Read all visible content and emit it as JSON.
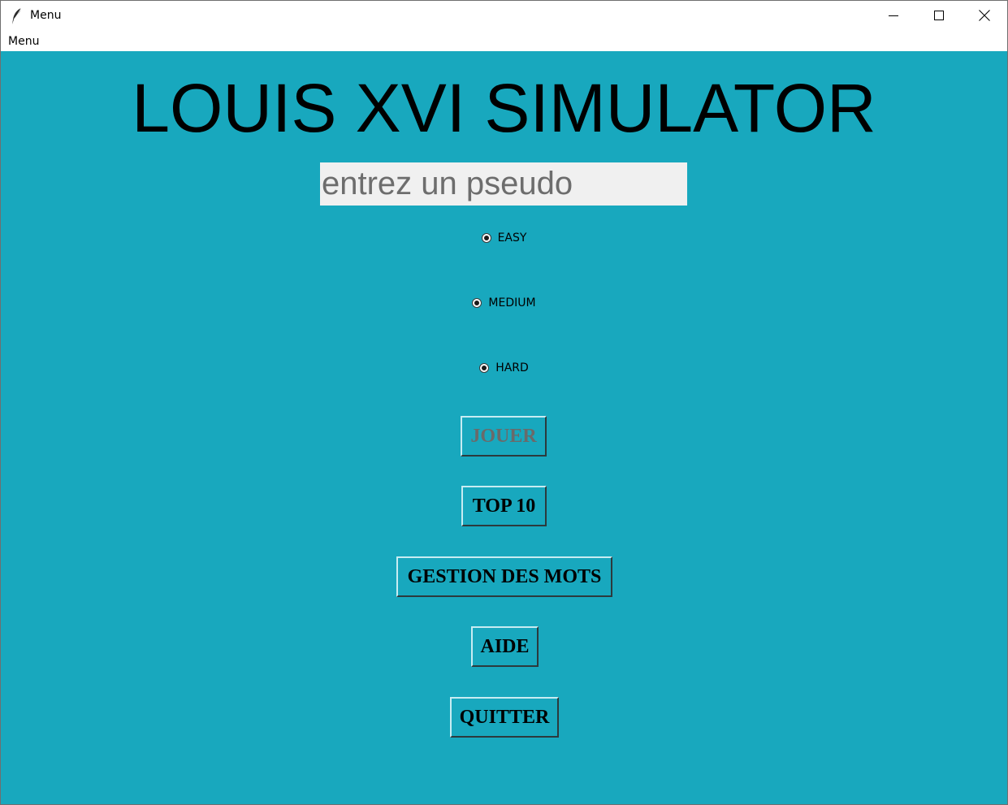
{
  "window": {
    "title": "Menu",
    "icon": "feather-icon",
    "controls": {
      "minimize_icon": "minimize-icon",
      "maximize_icon": "maximize-icon",
      "close_icon": "close-icon"
    }
  },
  "menubar": {
    "items": [
      {
        "label": "Menu"
      }
    ]
  },
  "main": {
    "background_color": "#18a8be",
    "title": "LOUIS XVI SIMULATOR",
    "pseudo_input": {
      "value": "",
      "placeholder": "entrez un pseudo"
    },
    "difficulty": {
      "options": [
        {
          "label": "EASY",
          "selected": true
        },
        {
          "label": "MEDIUM",
          "selected": true
        },
        {
          "label": "HARD",
          "selected": true
        }
      ]
    },
    "buttons": {
      "jouer": {
        "label": "JOUER",
        "disabled": true
      },
      "top10": {
        "label": "TOP 10"
      },
      "gestion": {
        "label": "GESTION DES MOTS"
      },
      "aide": {
        "label": "AIDE"
      },
      "quitter": {
        "label": "QUITTER"
      }
    }
  }
}
